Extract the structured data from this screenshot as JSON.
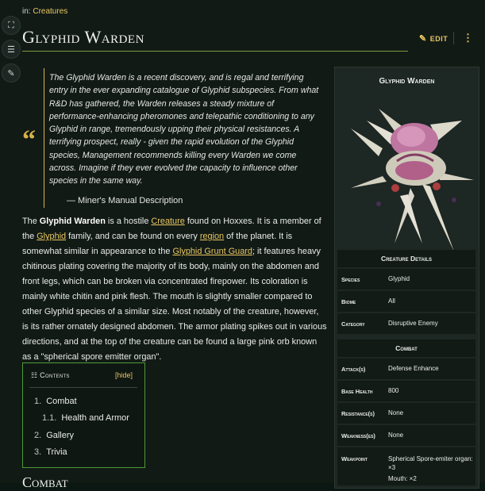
{
  "breadcrumb": {
    "prefix": "in:",
    "category": "Creatures"
  },
  "page_title": "Glyphid Warden",
  "actions": {
    "edit_label": "EDIT",
    "more_label": "⋮"
  },
  "quote": {
    "text": "The Glyphid Warden is a recent discovery, and is regal and terrifying entry in the ever expanding catalogue of Glyphid subspecies. From what R&D has gathered, the Warden releases a steady mixture of performance-enhancing pheromones and telepathic conditioning to any Glyphid in range, tremendously upping their physical resistances. A terrifying prospect, really - given the rapid evolution of the Glyphid species, Management recommends killing every Warden we come across. Imagine if they ever evolved the capacity to influence other species in the same way.",
    "attribution": "— Miner's Manual Description"
  },
  "body": {
    "p1": "The ",
    "name_bold": "Glyphid Warden",
    "p2": " is a hostile ",
    "link_creature": "Creature",
    "p3": " found on Hoxxes. It is a member of the ",
    "link_glyphid": "Glyphid",
    "p4": " family, and can be found on every ",
    "link_region": "region",
    "p5": " of the planet. It is somewhat similar in appearance to the ",
    "link_grunt_guard": "Glyphid Grunt Guard",
    "p6": "; it features heavy chitinous plating covering the majority of its body, mainly on the abdomen and front legs, which can be broken via concentrated firepower. Its coloration is mainly white chitin and pink flesh. The mouth is slightly smaller compared to other Glyphid species of a similar size. Most notably of the creature, however, is its rather ornately designed abdomen. The armor plating spikes out in various directions, and at the top of the creature can be found a large pink orb known as a \"spherical spore emitter organ\"."
  },
  "toc": {
    "heading": "Contents",
    "hide_label": "[hide]",
    "items": [
      {
        "num": "1.",
        "label": "Combat"
      },
      {
        "num": "1.1.",
        "label": "Health and Armor"
      },
      {
        "num": "2.",
        "label": "Gallery"
      },
      {
        "num": "3.",
        "label": "Trivia"
      }
    ]
  },
  "next_heading": "Combat",
  "infobox": {
    "title": "Glyphid Warden",
    "section_details": "Creature Details",
    "rows_details": [
      {
        "label": "Species",
        "value": "Glyphid"
      },
      {
        "label": "Biome",
        "value": "All"
      },
      {
        "label": "Category",
        "value": "Disruptive Enemy"
      }
    ],
    "section_combat": "Combat",
    "rows_combat": [
      {
        "label": "Attack(s)",
        "value": "Defense Enhance"
      },
      {
        "label": "Base Health",
        "value": "800"
      },
      {
        "label": "Resistance(s)",
        "value": "None"
      },
      {
        "label": "Weakness(es)",
        "value": "None"
      },
      {
        "label": "Weakpoint",
        "value": "Spherical Spore-emiter organ: ×3",
        "value2": "Mouth: ×2"
      }
    ]
  },
  "colors": {
    "accent": "#e8c760",
    "green_border": "#4f9a35",
    "background": "#121a16"
  }
}
